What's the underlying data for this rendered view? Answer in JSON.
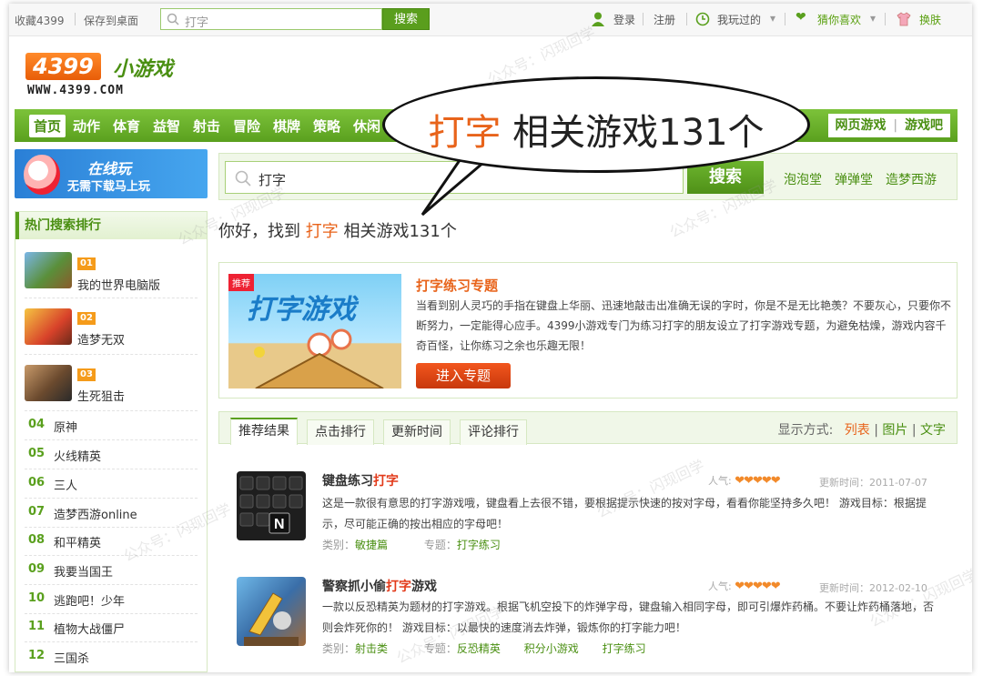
{
  "topbar": {
    "bookmark": "收藏4399",
    "save_desktop": "保存到桌面",
    "search_placeholder": "打字",
    "search_button": "搜索",
    "login": "登录",
    "register": "注册",
    "played": "我玩过的",
    "guess": "猜你喜欢",
    "skin": "换肤"
  },
  "logo": {
    "brand": "4399",
    "cn": "小游戏",
    "url": "WWW.4399.COM"
  },
  "nav": {
    "items": [
      "首页",
      "动作",
      "体育",
      "益智",
      "射击",
      "冒险",
      "棋牌",
      "策略",
      "休闲"
    ],
    "right_a": "网页游戏",
    "right_b": "游戏吧"
  },
  "callout": {
    "keyword": "打字",
    "rest": "相关游戏131个"
  },
  "banner": {
    "line1": "在线玩",
    "line2": "无需下载马上玩"
  },
  "sidebar": {
    "title": "热门搜索排行",
    "top": [
      {
        "badge": "01",
        "name": "我的世界电脑版"
      },
      {
        "badge": "02",
        "name": "造梦无双"
      },
      {
        "badge": "03",
        "name": "生死狙击"
      }
    ],
    "list": [
      {
        "num": "04",
        "name": "原神"
      },
      {
        "num": "05",
        "name": "火线精英"
      },
      {
        "num": "06",
        "name": "三人"
      },
      {
        "num": "07",
        "name": "造梦西游online"
      },
      {
        "num": "08",
        "name": "和平精英"
      },
      {
        "num": "09",
        "name": "我要当国王"
      },
      {
        "num": "10",
        "name": "逃跑吧！少年"
      },
      {
        "num": "11",
        "name": "植物大战僵尸"
      },
      {
        "num": "12",
        "name": "三国杀"
      }
    ]
  },
  "search": {
    "value": "打字",
    "button": "搜索",
    "links": [
      "泡泡堂",
      "弹弹堂",
      "造梦西游"
    ]
  },
  "result": {
    "prefix": "你好，找到",
    "keyword": "打字",
    "suffix": "相关游戏131个"
  },
  "topic": {
    "tag": "推荐",
    "img_title": "打字游戏",
    "title": "打字练习专题",
    "desc": "当看到别人灵巧的手指在键盘上华丽、迅速地敲击出准确无误的字时，你是不是无比艳羡？不要灰心，只要你不断努力，一定能得心应手。4399小游戏专门为练习打字的朋友设立了打字游戏专题，为避免枯燥，游戏内容千奇百怪，让你练习之余也乐趣无限！",
    "button": "进入专题"
  },
  "tabs": {
    "items": [
      "推荐结果",
      "点击排行",
      "更新时间",
      "评论排行"
    ],
    "display_label": "显示方式:",
    "display_list": "列表",
    "display_image": "图片",
    "display_text": "文字",
    "sep": "|"
  },
  "games": [
    {
      "title_a": "键盘练习",
      "title_hl": "打字",
      "title_b": "",
      "pop_label": "人气:",
      "hearts": "❤❤❤❤❤",
      "date": "更新时间：2011-07-07",
      "desc": "这是一款很有意思的打字游戏哦，键盘看上去很不错，要根据提示快速的按对字母，看看你能坚持多久吧！ 游戏目标：根据提示，尽可能正确的按出相应的字母吧！",
      "cat_label": "类别：",
      "cat": "敏捷篇",
      "topic_label": "专题：",
      "topics": [
        "打字练习"
      ]
    },
    {
      "title_a": "警察抓小偷",
      "title_hl": "打字",
      "title_b": "游戏",
      "pop_label": "人气:",
      "hearts": "❤❤❤❤❤",
      "date": "更新时间：2012-02-10",
      "desc": "一款以反恐精英为题材的打字游戏。根据飞机空投下的炸弹字母，键盘输入相同字母，即可引爆炸药桶。不要让炸药桶落地，否则会炸死你的！ 游戏目标：以最快的速度消去炸弹，锻炼你的打字能力吧！",
      "cat_label": "类别：",
      "cat": "射击类",
      "topic_label": "专题：",
      "topics": [
        "反恐精英",
        "积分小游戏",
        "打字练习"
      ]
    }
  ],
  "watermark": "公众号：闪现回学"
}
